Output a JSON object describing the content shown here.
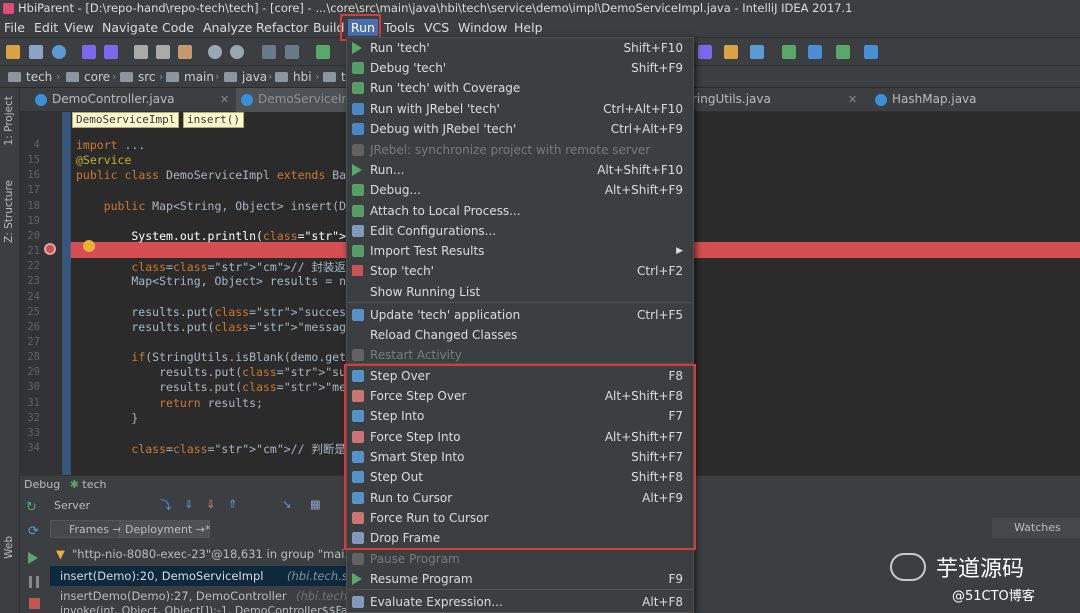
{
  "window": {
    "title": "HbiParent - [D:\\repo-hand\\repo-tech\\tech] - [core] - ...\\core\\src\\main\\java\\hbi\\tech\\service\\demo\\impl\\DemoServiceImpl.java - IntelliJ IDEA 2017.1"
  },
  "menubar": {
    "file": "File",
    "edit": "Edit",
    "view": "View",
    "navigate": "Navigate",
    "code": "Code",
    "analyze": "Analyze",
    "refactor": "Refactor",
    "build": "Build",
    "run": "Run",
    "tools": "Tools",
    "vcs": "VCS",
    "window": "Window",
    "help": "Help"
  },
  "navbar": {
    "crumbs": [
      "tech",
      "core",
      "src",
      "main",
      "java",
      "hbi",
      "t"
    ]
  },
  "tabs": [
    {
      "label": "DemoController.java"
    },
    {
      "label": "DemoServiceIm"
    },
    {
      "label": "ringUtils.java"
    },
    {
      "label": "HashMap.java"
    }
  ],
  "editor_breadcrumb": {
    "class": "DemoServiceImpl",
    "method": "insert()"
  },
  "editor": {
    "lines": [
      {
        "n": "4",
        "t": "import ..."
      },
      {
        "n": "15",
        "t": "@Service"
      },
      {
        "n": "16",
        "t": "public class DemoServiceImpl extends Bas"
      },
      {
        "n": "17",
        "t": ""
      },
      {
        "n": "18",
        "t": "    public Map<String, Object> insert(De"
      },
      {
        "n": "19",
        "t": ""
      },
      {
        "n": "20",
        "t": "        System.out.println(\"-----------"
      },
      {
        "n": "21",
        "t": ""
      },
      {
        "n": "22",
        "t": "        // 封装返回结果"
      },
      {
        "n": "23",
        "t": "        Map<String, Object> results = ne"
      },
      {
        "n": "24",
        "t": ""
      },
      {
        "n": "25",
        "t": "        results.put(\"success\", null); //"
      },
      {
        "n": "26",
        "t": "        results.put(\"message\", null); //"
      },
      {
        "n": "27",
        "t": ""
      },
      {
        "n": "28",
        "t": "        if(StringUtils.isBlank(demo.getI"
      },
      {
        "n": "29",
        "t": "            results.put(\"success\", false"
      },
      {
        "n": "30",
        "t": "            results.put(\"message\", \"IdCa"
      },
      {
        "n": "31",
        "t": "            return results;"
      },
      {
        "n": "32",
        "t": "        }"
      },
      {
        "n": "33",
        "t": ""
      },
      {
        "n": "34",
        "t": "        // 判断是否存在相同IdCard"
      }
    ]
  },
  "side_labels": {
    "project": "1: Project",
    "structure": "Z: Structure",
    "web": "Web"
  },
  "debug": {
    "title": "Debug",
    "config": "tech",
    "server_tab": "Server",
    "frames_tab": "Frames →*",
    "deployment_tab": "Deployment →*",
    "thread": "\"http-nio-8080-exec-23\"@18,631 in group \"mai...",
    "frames": [
      {
        "method": "insert(Demo):20, DemoServiceImpl",
        "pkg": "(hbi.tech.service."
      },
      {
        "method": "insertDemo(Demo):27, DemoController",
        "pkg": "(hbi.tech.co"
      },
      {
        "method": "invoke(int, Object, Object[]):-1, DemoController$$Fa",
        "pkg": ""
      }
    ],
    "watches": "Watches"
  },
  "run_menu": {
    "items": [
      {
        "label": "Run 'tech'",
        "shortcut": "Shift+F10",
        "icon": "run-icon",
        "disabled": false
      },
      {
        "label": "Debug 'tech'",
        "shortcut": "Shift+F9",
        "icon": "debug-icon",
        "disabled": false
      },
      {
        "label": "Run 'tech' with Coverage",
        "shortcut": "",
        "icon": "coverage-icon",
        "disabled": false
      },
      {
        "label": "Run with JRebel 'tech'",
        "shortcut": "Ctrl+Alt+F10",
        "icon": "jrebel-run-icon",
        "disabled": false
      },
      {
        "label": "Debug with JRebel 'tech'",
        "shortcut": "Ctrl+Alt+F9",
        "icon": "jrebel-debug-icon",
        "disabled": false
      },
      {
        "label": "JRebel: synchronize project with remote server",
        "shortcut": "",
        "icon": "jrebel-sync-icon",
        "disabled": true
      },
      {
        "label": "Run...",
        "shortcut": "Alt+Shift+F10",
        "icon": "run-icon",
        "disabled": false
      },
      {
        "label": "Debug...",
        "shortcut": "Alt+Shift+F9",
        "icon": "debug-icon",
        "disabled": false
      },
      {
        "label": "Attach to Local Process...",
        "shortcut": "",
        "icon": "attach-icon",
        "disabled": false
      },
      {
        "label": "Edit Configurations...",
        "shortcut": "",
        "icon": "edit-config-icon",
        "disabled": false
      },
      {
        "label": "Import Test Results",
        "shortcut": "▶",
        "icon": "import-icon",
        "disabled": false
      },
      {
        "label": "Stop 'tech'",
        "shortcut": "Ctrl+F2",
        "icon": "stop-icon",
        "disabled": false
      },
      {
        "label": "Show Running List",
        "shortcut": "",
        "icon": "",
        "disabled": false
      },
      {
        "label": "Update 'tech' application",
        "shortcut": "Ctrl+F5",
        "icon": "update-icon",
        "disabled": false
      },
      {
        "label": "Reload Changed Classes",
        "shortcut": "",
        "icon": "",
        "disabled": false
      },
      {
        "label": "Restart Activity",
        "shortcut": "",
        "icon": "restart-icon",
        "disabled": true
      },
      {
        "label": "Step Over",
        "shortcut": "F8",
        "icon": "step-over-icon",
        "disabled": false
      },
      {
        "label": "Force Step Over",
        "shortcut": "Alt+Shift+F8",
        "icon": "force-step-over-icon",
        "disabled": false
      },
      {
        "label": "Step Into",
        "shortcut": "F7",
        "icon": "step-into-icon",
        "disabled": false
      },
      {
        "label": "Force Step Into",
        "shortcut": "Alt+Shift+F7",
        "icon": "force-step-into-icon",
        "disabled": false
      },
      {
        "label": "Smart Step Into",
        "shortcut": "Shift+F7",
        "icon": "smart-step-into-icon",
        "disabled": false
      },
      {
        "label": "Step Out",
        "shortcut": "Shift+F8",
        "icon": "step-out-icon",
        "disabled": false
      },
      {
        "label": "Run to Cursor",
        "shortcut": "Alt+F9",
        "icon": "run-to-cursor-icon",
        "disabled": false
      },
      {
        "label": "Force Run to Cursor",
        "shortcut": "",
        "icon": "force-run-to-cursor-icon",
        "disabled": false
      },
      {
        "label": "Drop Frame",
        "shortcut": "",
        "icon": "drop-frame-icon",
        "disabled": false
      },
      {
        "label": "Pause Program",
        "shortcut": "",
        "icon": "pause-icon",
        "disabled": true
      },
      {
        "label": "Resume Program",
        "shortcut": "F9",
        "icon": "resume-icon",
        "disabled": false
      },
      {
        "label": "Evaluate Expression...",
        "shortcut": "Alt+F8",
        "icon": "evaluate-icon",
        "disabled": false
      }
    ]
  },
  "watermark": {
    "brand": "芋道源码",
    "site": "@51CTO博客"
  },
  "colors": {
    "accent": "#4b6eaf",
    "breakpoint_line": "#d54e52",
    "highlight_border": "#d93b3b",
    "ide_bg": "#2b2b2b",
    "panel_bg": "#3c3f41"
  }
}
